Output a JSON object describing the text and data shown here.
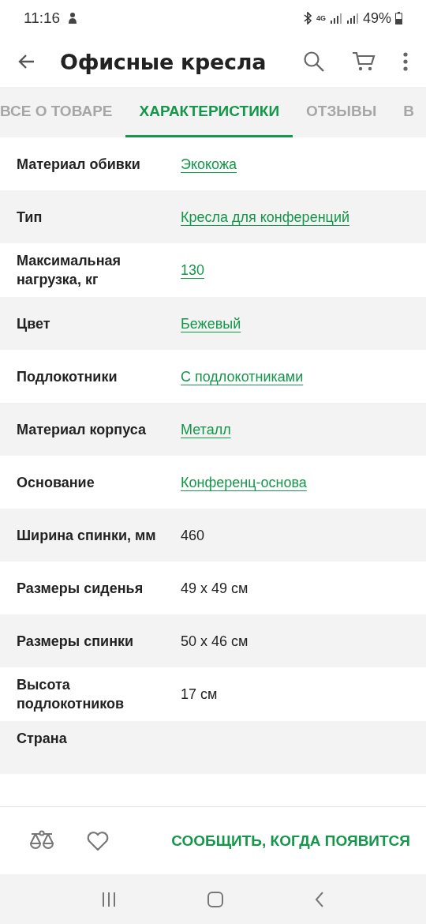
{
  "status_bar": {
    "time": "11:16",
    "battery": "49%",
    "network": "4G"
  },
  "header": {
    "title": "Офисные кресла"
  },
  "tabs": [
    {
      "label": "ВСЕ О ТОВАРЕ",
      "selected": false
    },
    {
      "label": "ХАРАКТЕРИСТИКИ",
      "selected": true
    },
    {
      "label": "ОТЗЫВЫ",
      "selected": false
    },
    {
      "label": "В",
      "selected": false
    }
  ],
  "specs": [
    {
      "name": "Материал обивки",
      "value": "Экокожа",
      "kind": "link"
    },
    {
      "name": "Тип",
      "value": "Кресла для конференций",
      "kind": "link"
    },
    {
      "name": "Максимальная нагрузка, кг",
      "value": "130",
      "kind": "link"
    },
    {
      "name": "Цвет",
      "value": "Бежевый",
      "kind": "link"
    },
    {
      "name": "Подлокотники",
      "value": "С подлокотниками",
      "kind": "link"
    },
    {
      "name": "Материал корпуса",
      "value": "Металл",
      "kind": "link"
    },
    {
      "name": "Основание",
      "value": "Конференц-основа",
      "kind": "link"
    },
    {
      "name": "Ширина спинки, мм",
      "value": "460",
      "kind": "text"
    },
    {
      "name": "Размеры сиденья",
      "value": "49 x 49 см",
      "kind": "text"
    },
    {
      "name": "Размеры спинки",
      "value": "50 x 46 см",
      "kind": "text"
    },
    {
      "name": "Высота подлокотников",
      "value": "17 см",
      "kind": "text"
    },
    {
      "name": "Страна",
      "kind": "cut"
    }
  ],
  "action_bar": {
    "notify_button": "СООБЩИТЬ, КОГДА ПОЯВИТСЯ"
  }
}
